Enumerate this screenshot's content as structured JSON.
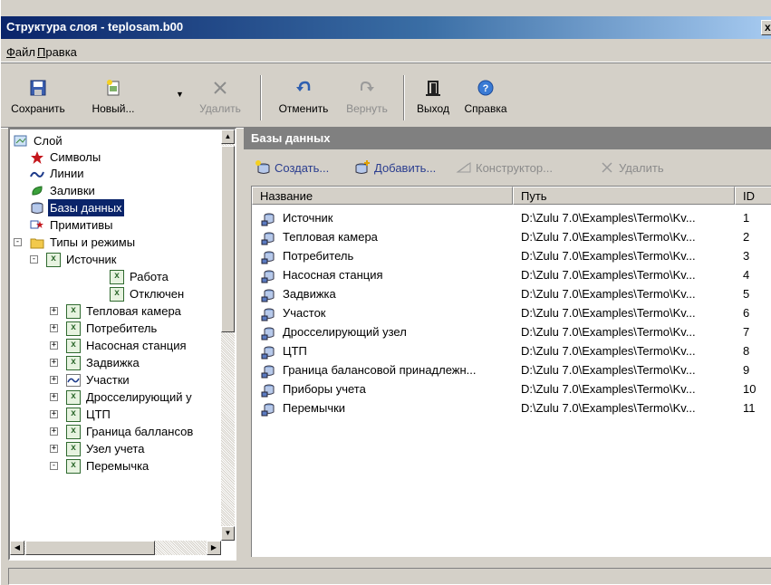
{
  "window": {
    "title": "Структура слоя - teplosam.b00",
    "close_label": "x"
  },
  "menu": {
    "items": [
      "Файл",
      "Правка"
    ]
  },
  "toolbar": {
    "save": "Сохранить",
    "new": "Новый...",
    "delete": "Удалить",
    "undo": "Отменить",
    "redo": "Вернуть",
    "exit": "Выход",
    "help": "Справка"
  },
  "tree": {
    "items": [
      {
        "label": "Слой",
        "icon": "layer-icon"
      },
      {
        "label": "Символы",
        "icon": "star-icon"
      },
      {
        "label": "Линии",
        "icon": "line-icon"
      },
      {
        "label": "Заливки",
        "icon": "fill-icon"
      },
      {
        "label": "Базы данных",
        "icon": "database-icon",
        "selected": true
      },
      {
        "label": "Примитивы",
        "icon": "primitives-icon"
      },
      {
        "label": "Типы и режимы",
        "icon": "folder-icon",
        "expander": "minus"
      },
      {
        "label": "Источник",
        "icon": "type-icon",
        "expander": "minus"
      },
      {
        "label": "Работа",
        "icon": "mode-icon"
      },
      {
        "label": "Отключен",
        "icon": "mode-icon"
      },
      {
        "label": "Тепловая камера",
        "icon": "type-icon",
        "expander": "plus"
      },
      {
        "label": "Потребитель",
        "icon": "type-icon",
        "expander": "plus"
      },
      {
        "label": "Насосная станция",
        "icon": "type-icon",
        "expander": "plus"
      },
      {
        "label": "Задвижка",
        "icon": "type-icon",
        "expander": "plus"
      },
      {
        "label": "Участки",
        "icon": "line-type-icon",
        "expander": "plus"
      },
      {
        "label": "Дросселирующий у",
        "icon": "type-icon",
        "expander": "plus"
      },
      {
        "label": "ЦТП",
        "icon": "type-icon",
        "expander": "plus"
      },
      {
        "label": "Граница баллансов",
        "icon": "type-icon",
        "expander": "plus"
      },
      {
        "label": "Узел учета",
        "icon": "type-icon",
        "expander": "plus"
      },
      {
        "label": "Перемычка",
        "icon": "type-icon",
        "expander": "minus"
      }
    ]
  },
  "db_panel": {
    "title": "Базы данных",
    "actions": {
      "create": "Создать...",
      "add": "Добавить...",
      "designer": "Конструктор...",
      "delete": "Удалить"
    },
    "columns": {
      "name": "Название",
      "path": "Путь",
      "id": "ID"
    },
    "rows": [
      {
        "name": "Источник",
        "path": "D:\\Zulu 7.0\\Examples\\Termo\\Kv...",
        "id": "1"
      },
      {
        "name": "Тепловая камера",
        "path": "D:\\Zulu 7.0\\Examples\\Termo\\Kv...",
        "id": "2"
      },
      {
        "name": "Потребитель",
        "path": "D:\\Zulu 7.0\\Examples\\Termo\\Kv...",
        "id": "3"
      },
      {
        "name": "Насосная станция",
        "path": "D:\\Zulu 7.0\\Examples\\Termo\\Kv...",
        "id": "4"
      },
      {
        "name": "Задвижка",
        "path": "D:\\Zulu 7.0\\Examples\\Termo\\Kv...",
        "id": "5"
      },
      {
        "name": "Участок",
        "path": "D:\\Zulu 7.0\\Examples\\Termo\\Kv...",
        "id": "6"
      },
      {
        "name": "Дросселирующий узел",
        "path": "D:\\Zulu 7.0\\Examples\\Termo\\Kv...",
        "id": "7"
      },
      {
        "name": "ЦТП",
        "path": "D:\\Zulu 7.0\\Examples\\Termo\\Kv...",
        "id": "8"
      },
      {
        "name": "Граница балансовой принадлежн...",
        "path": "D:\\Zulu 7.0\\Examples\\Termo\\Kv...",
        "id": "9"
      },
      {
        "name": "Приборы учета",
        "path": "D:\\Zulu 7.0\\Examples\\Termo\\Kv...",
        "id": "10"
      },
      {
        "name": "Перемычки",
        "path": "D:\\Zulu 7.0\\Examples\\Termo\\Kv...",
        "id": "11"
      }
    ]
  },
  "colors": {
    "titlebar": "#0a246a",
    "selection": "#0a246a",
    "panel_header": "#808080",
    "action_text": "#2a3d8f"
  }
}
